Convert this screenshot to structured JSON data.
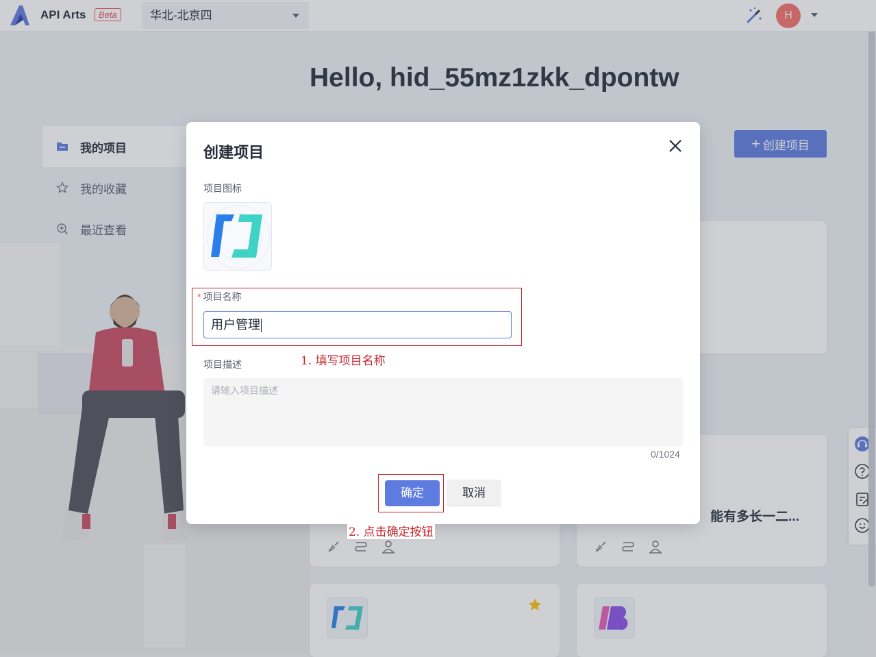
{
  "header": {
    "app_name": "API Arts",
    "beta_badge": "Beta",
    "region": "华北-北京四",
    "avatar_letter": "H"
  },
  "greeting": "Hello, hid_55mz1zkk_dpontw",
  "sidebar": {
    "items": [
      {
        "label": "我的项目",
        "icon": "folder-icon",
        "active": true
      },
      {
        "label": "我的收藏",
        "icon": "star-outline-icon",
        "active": false
      },
      {
        "label": "最近查看",
        "icon": "zoom-search-icon",
        "active": false
      }
    ]
  },
  "create_project_button": "创建项目",
  "cards": [
    {
      "title": "",
      "icons": [
        "api-icon",
        "flow-icon",
        "user-icon"
      ]
    },
    {
      "title": "能有多长一二...",
      "icons": [
        "api-icon",
        "flow-icon",
        "user-icon"
      ]
    }
  ],
  "modal": {
    "title": "创建项目",
    "icon_label": "项目图标",
    "name_label": "项目名称",
    "required_mark": "*",
    "name_value": "用户管理",
    "desc_label": "项目描述",
    "desc_placeholder": "请输入项目描述",
    "counter": "0/1024",
    "ok_label": "确定",
    "cancel_label": "取消"
  },
  "annotations": {
    "step1": "1.  填写项目名称",
    "step2": "2. 点击确定按钮"
  },
  "colors": {
    "primary": "#5e7ce0",
    "annotation": "#c6262b",
    "avatar": "#f66f6a",
    "required": "#e34d59"
  }
}
